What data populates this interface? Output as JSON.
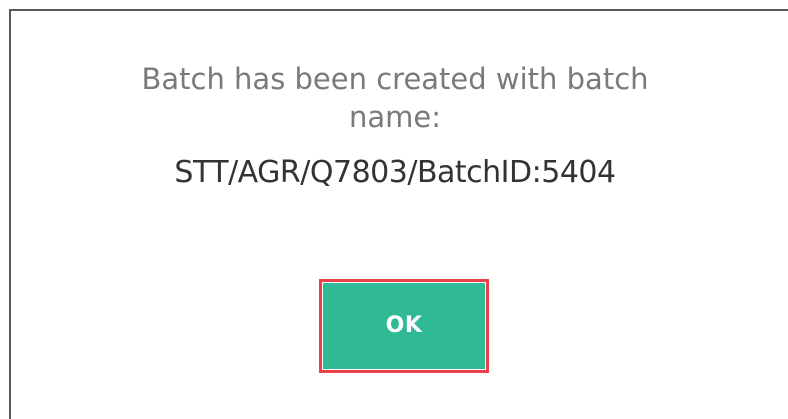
{
  "dialog": {
    "message_line1": "Batch has been created with batch",
    "message_line2": "name:",
    "batch_name": "STT/AGR/Q7803/BatchID:5404",
    "ok_label": "OK"
  },
  "colors": {
    "ok_button": "#2fba95",
    "highlight_border": "#e8424a"
  }
}
